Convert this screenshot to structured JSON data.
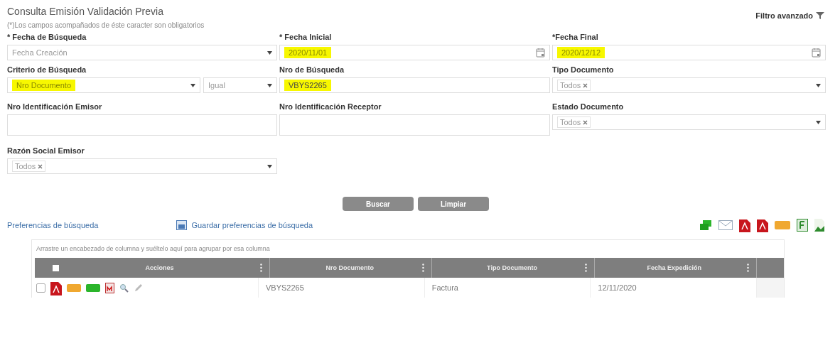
{
  "title": "Consulta Emisión Validación Previa",
  "note": "(*)Los campos acompañados de éste caracter son obligatorios",
  "advanced_filter": "Filtro avanzado",
  "fields": [
    {
      "kind": "select",
      "label": "* Fecha de Búsqueda",
      "value": "Fecha Creación",
      "highlighted": false
    },
    {
      "kind": "date",
      "label": "* Fecha Inicial",
      "value": "2020/11/01",
      "highlighted": true
    },
    {
      "kind": "date",
      "label": "*Fecha Final",
      "value": "2020/12/12",
      "highlighted": true
    },
    {
      "kind": "select_pair",
      "label": "Criterio de Búsqueda",
      "value": "Nro Documento",
      "operator": "Igual",
      "highlighted": true
    },
    {
      "kind": "text",
      "label": "Nro de Búsqueda",
      "value": "VBYS2265",
      "highlighted": true
    },
    {
      "kind": "tags",
      "label": "Tipo Documento",
      "tags": [
        "Todos"
      ]
    },
    {
      "kind": "text",
      "label": "Nro Identificación Emisor"
    },
    {
      "kind": "text",
      "label": "Nro Identificación Receptor"
    },
    {
      "kind": "tags",
      "label": "Estado Documento",
      "tags": [
        "Todos"
      ]
    },
    {
      "kind": "tags",
      "label": "Razón Social Emisor",
      "tags": [
        "Todos"
      ]
    }
  ],
  "buttons": [
    "Buscar",
    "Limpiar"
  ],
  "preferences_link": "Preferencias de búsqueda",
  "save_preferences_link": "Guardar preferencias de búsqueda",
  "grid": {
    "group_hint": "Arrastre un encabezado de columna y suéltelo aquí para agrupar por esa columna",
    "select_all_checked": false,
    "columns": [
      "Acciones",
      "Nro Documento",
      "Tipo Documento",
      "Fecha Expedición"
    ],
    "rows": [
      {
        "checked": false,
        "cells": [
          "VBYS2265",
          "Factura",
          "12/11/2020"
        ]
      }
    ]
  }
}
